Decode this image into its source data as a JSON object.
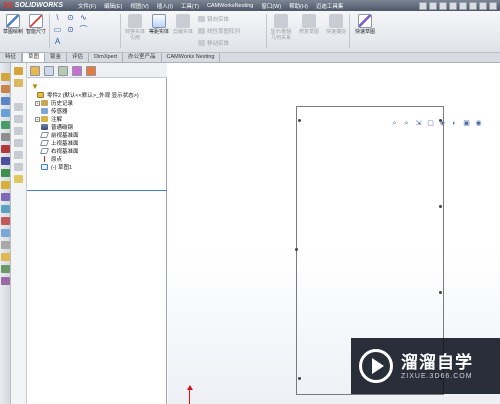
{
  "titlebar": {
    "brand_ds": "3S",
    "brand_name": "SOLIDWORKS",
    "menus": [
      "文件(F)",
      "编辑(E)",
      "视图(V)",
      "插入(I)",
      "工具(T)",
      "CAMWorksNesting",
      "窗口(W)",
      "帮助(H)",
      "迈迪工具集"
    ]
  },
  "ribbon": {
    "sketch_draw": "草图绘制",
    "smart_dim": "智能尺寸",
    "line_tools": [
      "\\",
      "⊙",
      "∿",
      "▭",
      "⊙",
      "⌒",
      "A"
    ],
    "convert": "转换实体引用",
    "offset": "等距实体",
    "mirror": "镜向实体",
    "linear_array": "线性草图阵列",
    "move": "移动实体",
    "trim": "剪裁实体",
    "display_delete": "显示/删除几何关系",
    "repair": "修复草图",
    "quick_snap": "快速捕捉",
    "rapid_sketch": "快速草图"
  },
  "tabs": [
    "特征",
    "草图",
    "钣金",
    "评估",
    "DimXpert",
    "办公室产品",
    "CAMWorks Nesting"
  ],
  "active_tab": "草图",
  "tree": {
    "root": "零件2 (默认<<默认>_外观 显示状态>)",
    "items": [
      {
        "label": "历史记录",
        "expander": "+"
      },
      {
        "label": "传感器",
        "expander": ""
      },
      {
        "label": "注解",
        "expander": "+"
      },
      {
        "label": "普通碳钢",
        "expander": ""
      },
      {
        "label": "前视基准面",
        "expander": ""
      },
      {
        "label": "上视基准面",
        "expander": ""
      },
      {
        "label": "右视基准面",
        "expander": ""
      },
      {
        "label": "原点",
        "expander": ""
      },
      {
        "label": "(-) 草图1",
        "expander": ""
      }
    ]
  },
  "heads_up": [
    "⌕",
    "⌕",
    "⇲",
    "▢",
    "◈",
    "◐",
    "▣",
    "◉"
  ],
  "watermark": {
    "title": "溜溜自学",
    "subtitle": "ZIXUE.3D66.COM"
  },
  "colors": {
    "menu_bar": "#5a6474",
    "ribbon": "#e8ebef",
    "selection_line": "#3c7fd0",
    "origin_arrow": "#dd1111"
  }
}
